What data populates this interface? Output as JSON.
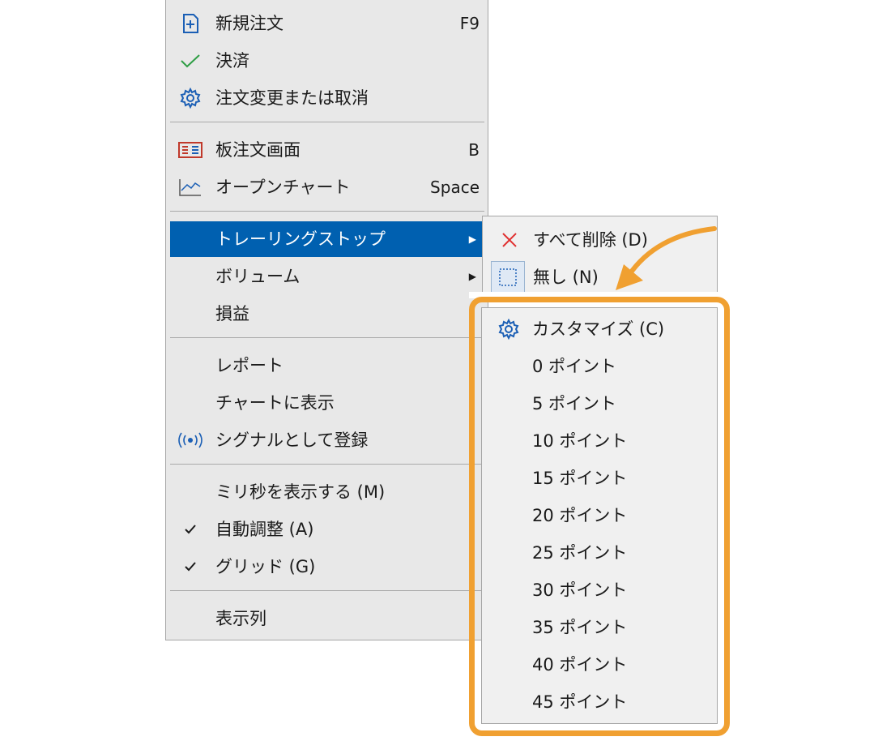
{
  "context_menu": {
    "items": [
      {
        "label": "新規注文",
        "shortcut": "F9",
        "icon": "new-order-icon"
      },
      {
        "label": "決済",
        "shortcut": "",
        "icon": "checkmark-icon"
      },
      {
        "label": "注文変更または取消",
        "shortcut": "",
        "icon": "gear-icon"
      },
      {
        "label": "板注文画面",
        "shortcut": "B",
        "icon": "order-board-icon"
      },
      {
        "label": "オープンチャート",
        "shortcut": "Space",
        "icon": "line-chart-icon"
      },
      {
        "label": "トレーリングストップ",
        "shortcut": "",
        "icon": ""
      },
      {
        "label": "ボリューム",
        "shortcut": "",
        "icon": ""
      },
      {
        "label": "損益",
        "shortcut": "",
        "icon": ""
      },
      {
        "label": "レポート",
        "shortcut": "",
        "icon": ""
      },
      {
        "label": "チャートに表示",
        "shortcut": "",
        "icon": ""
      },
      {
        "label": "シグナルとして登録",
        "shortcut": "",
        "icon": "signal-broadcast-icon"
      },
      {
        "label": "ミリ秒を表示する (M)",
        "shortcut": "",
        "icon": ""
      },
      {
        "label": "自動調整 (A)",
        "shortcut": "",
        "icon": "check-icon"
      },
      {
        "label": "グリッド (G)",
        "shortcut": "",
        "icon": "check-icon"
      },
      {
        "label": "表示列",
        "shortcut": "",
        "icon": ""
      }
    ],
    "active_item": "トレーリングストップ",
    "colors": {
      "highlight": "#0060b0",
      "callout": "#f0a031"
    }
  },
  "submenu": {
    "items": [
      {
        "label": "すべて削除 (D)",
        "icon": "delete-x-icon"
      },
      {
        "label": "無し (N)",
        "icon": "none-dashed-box-icon"
      },
      {
        "label": "カスタマイズ (C)",
        "icon": "gear-icon"
      },
      {
        "label": "0 ポイント"
      },
      {
        "label": "5 ポイント"
      },
      {
        "label": "10 ポイント"
      },
      {
        "label": "15 ポイント"
      },
      {
        "label": "20 ポイント"
      },
      {
        "label": "25 ポイント"
      },
      {
        "label": "30 ポイント"
      },
      {
        "label": "35 ポイント"
      },
      {
        "label": "40 ポイント"
      },
      {
        "label": "45 ポイント"
      }
    ]
  }
}
